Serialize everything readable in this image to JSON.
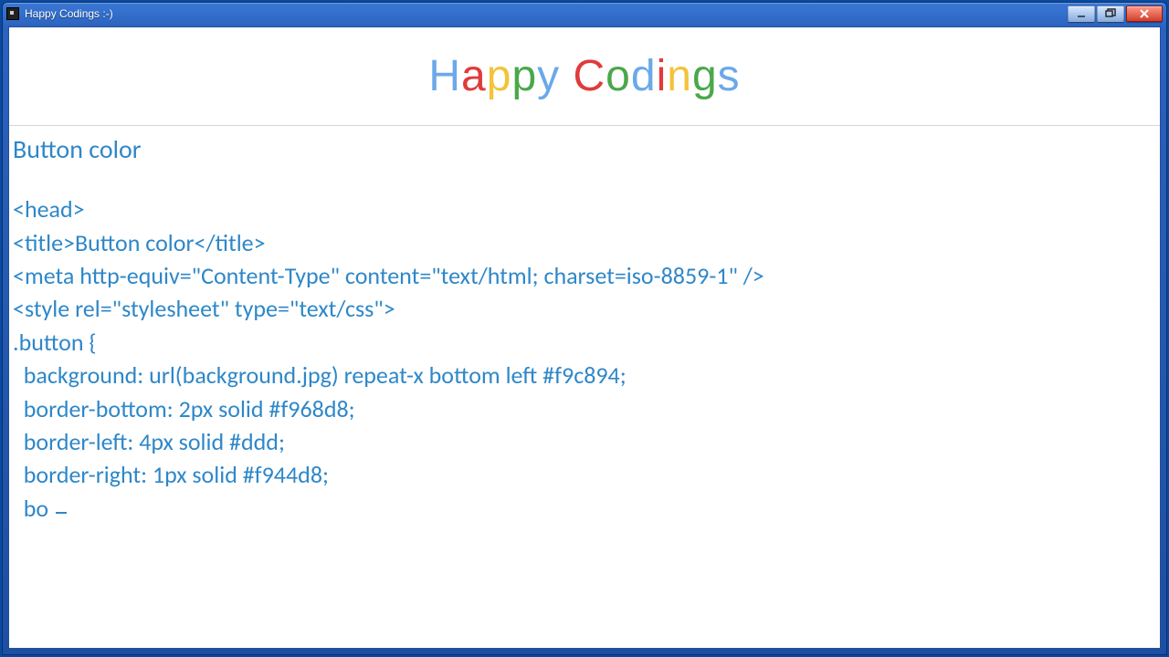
{
  "window": {
    "title": "Happy Codings :-)"
  },
  "logo": {
    "letters": [
      {
        "c": "H",
        "color": "#6aa9e9"
      },
      {
        "c": "a",
        "color": "#e03b3b"
      },
      {
        "c": "p",
        "color": "#f2c33b"
      },
      {
        "c": "p",
        "color": "#4aa84a"
      },
      {
        "c": "y",
        "color": "#6aa9e9"
      },
      {
        "c": " ",
        "color": "#000"
      },
      {
        "c": "C",
        "color": "#e03b3b"
      },
      {
        "c": "o",
        "color": "#4aa84a"
      },
      {
        "c": "d",
        "color": "#6aa9e9"
      },
      {
        "c": "i",
        "color": "#e03b3b"
      },
      {
        "c": "n",
        "color": "#f2c33b"
      },
      {
        "c": "g",
        "color": "#4aa84a"
      },
      {
        "c": "s",
        "color": "#6aa9e9"
      }
    ]
  },
  "doc": {
    "heading": "Button color",
    "lines": [
      "<head>",
      "<title>Button color</title>",
      "<meta http-equiv=\"Content-Type\" content=\"text/html; charset=iso-8859-1\" />",
      "<style rel=\"stylesheet\" type=\"text/css\">",
      ".button {",
      "  background: url(background.jpg) repeat-x bottom left #f9c894;",
      "  border-bottom: 2px solid #f968d8;",
      "  border-left: 4px solid #ddd;",
      "  border-right: 1px solid #f944d8;",
      "  bo"
    ]
  }
}
